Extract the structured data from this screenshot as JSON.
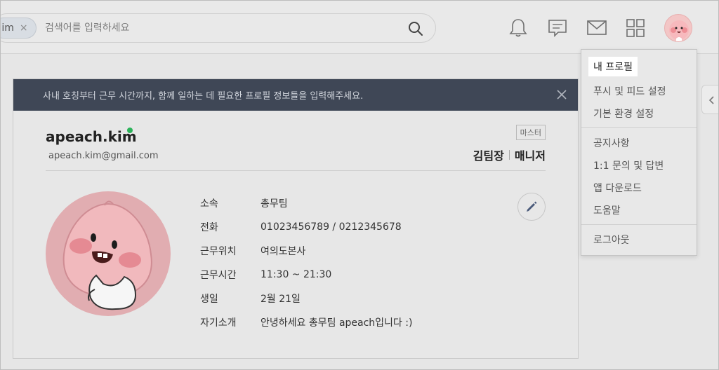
{
  "search": {
    "chip_label": "im",
    "chip_remove": "×",
    "placeholder": "검색어를 입력하세요"
  },
  "banner": {
    "message": "사내 호칭부터 근무 시간까지, 함께 일하는 데 필요한 프로필 정보들을 입력해주세요."
  },
  "profile": {
    "username": "apeach.kim",
    "email": "apeach.kim@gmail.com",
    "role_badge": "마스터",
    "position": "김팀장",
    "role": "매니저",
    "fields": [
      {
        "label": "소속",
        "value": "총무팀"
      },
      {
        "label": "전화",
        "value": "01023456789 / 0212345678"
      },
      {
        "label": "근무위치",
        "value": "여의도본사"
      },
      {
        "label": "근무시간",
        "value": "11:30 ~ 21:30"
      },
      {
        "label": "생일",
        "value": "2월 21일"
      },
      {
        "label": "자기소개",
        "value": "안녕하세요 총무팀 apeach입니다 :)"
      }
    ]
  },
  "menu": {
    "items": [
      {
        "label": "내 프로필"
      },
      {
        "label": "푸시 및 피드 설정"
      },
      {
        "label": "기본 환경 설정"
      },
      {
        "label": "공지사항"
      },
      {
        "label": "1:1 문의 및 답변"
      },
      {
        "label": "앱 다운로드"
      },
      {
        "label": "도움말"
      },
      {
        "label": "로그아웃"
      }
    ]
  },
  "colors": {
    "banner_bg": "#3f4756",
    "online": "#2cb35a",
    "avatar_pink": "#f3c6c6"
  }
}
